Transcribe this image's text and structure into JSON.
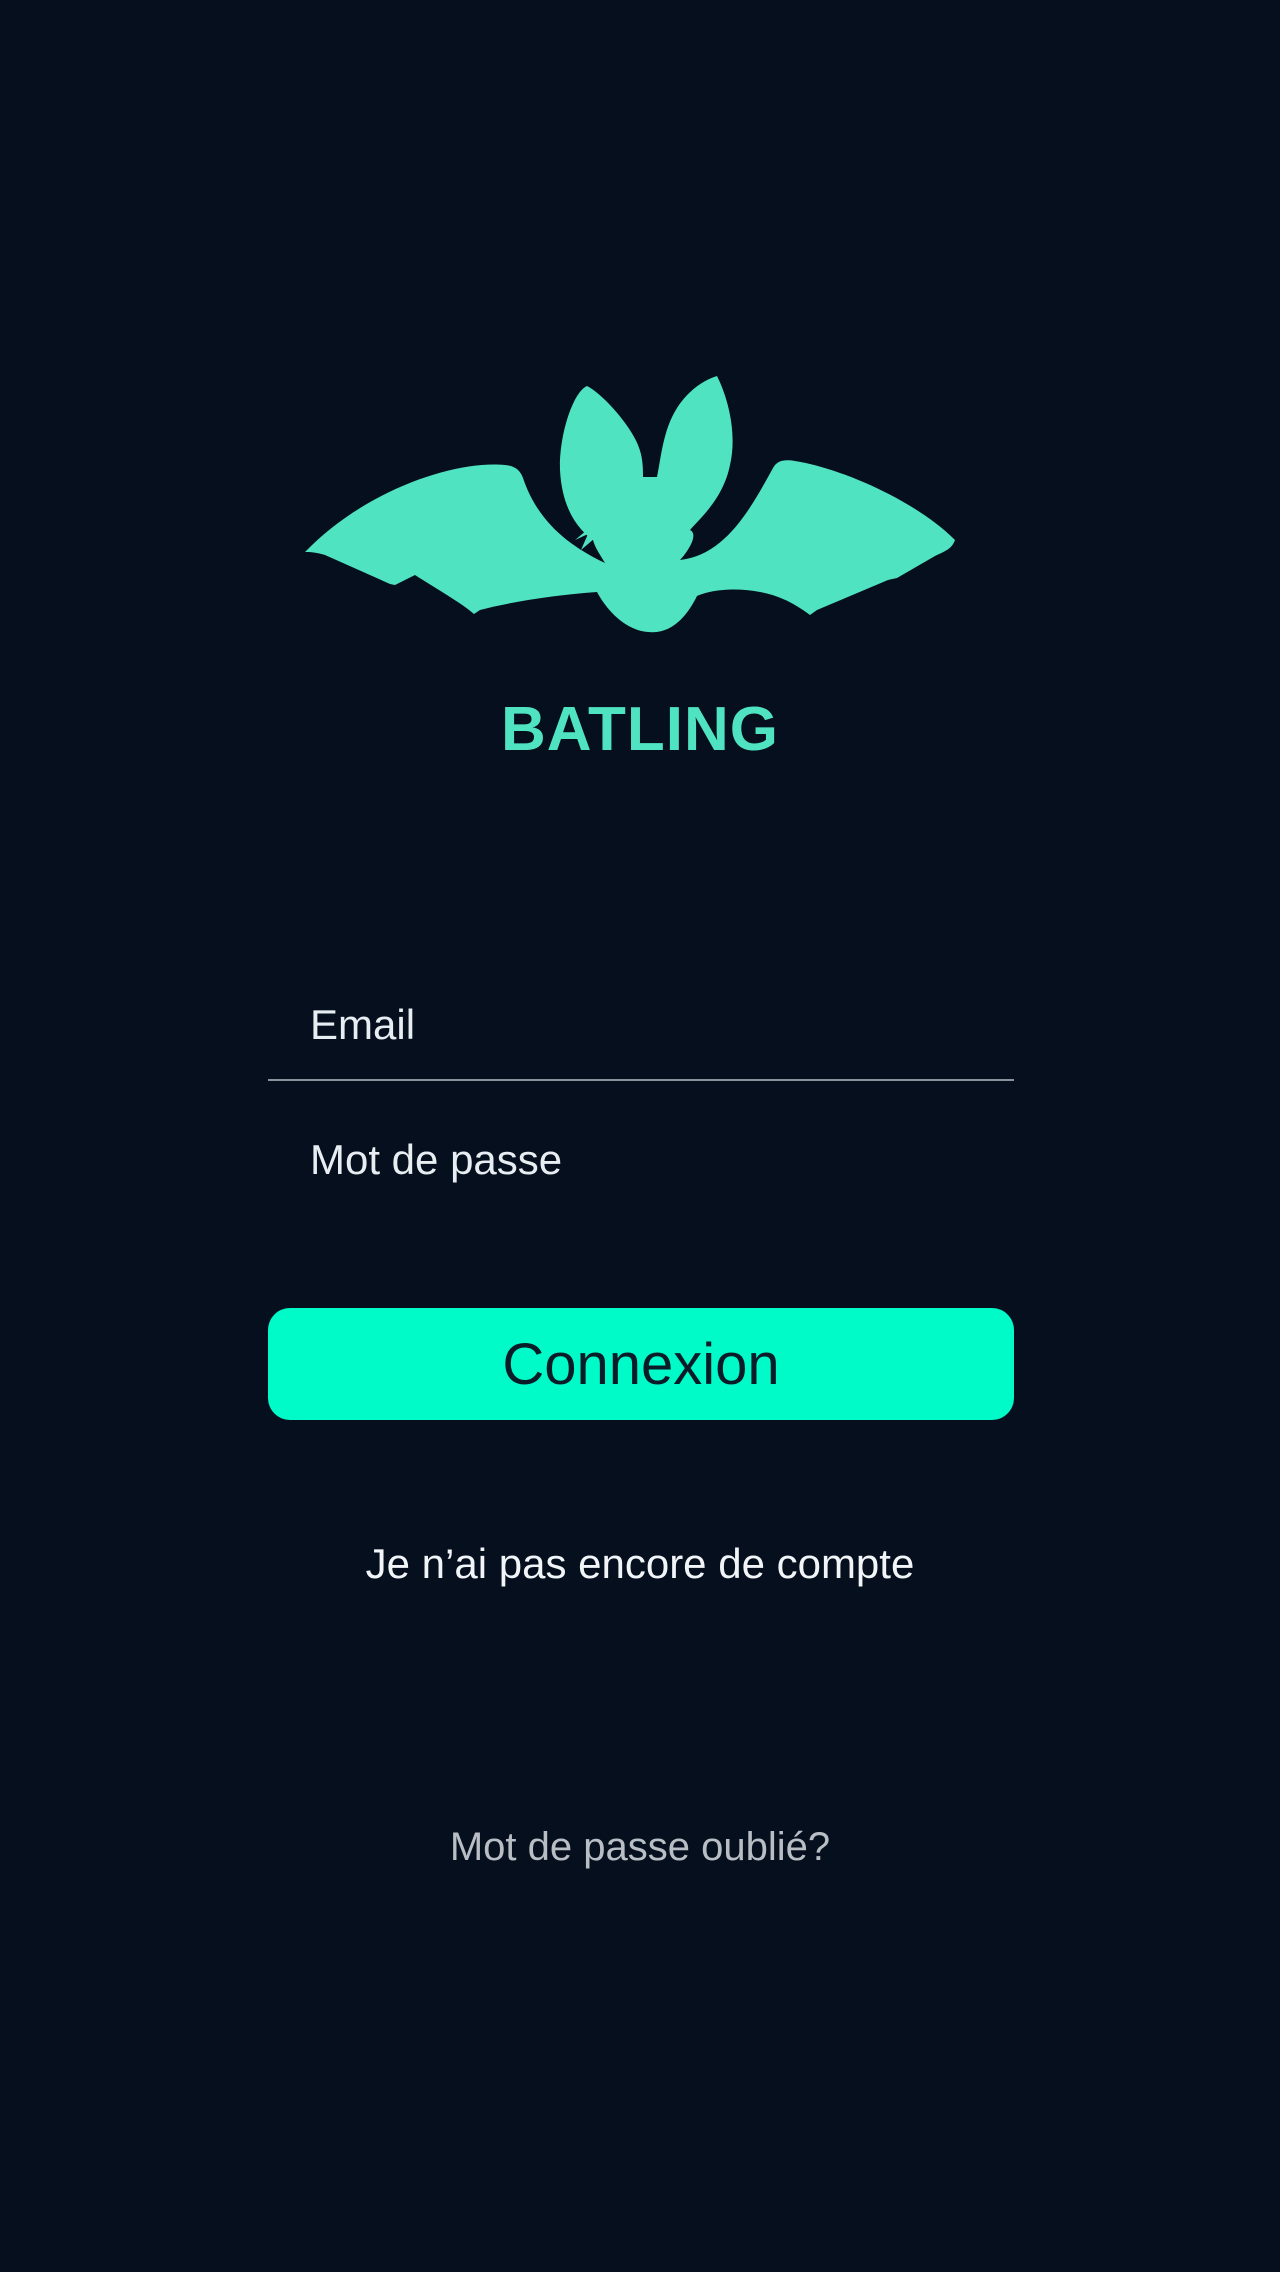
{
  "app": {
    "name": "BATLING",
    "logo_icon": "bat-icon"
  },
  "colors": {
    "background": "#050f1e",
    "brand": "#50e3c2",
    "accent": "#00fac8"
  },
  "form": {
    "email_placeholder": "Email",
    "email_value": "",
    "password_placeholder": "Mot de passe",
    "password_value": "",
    "submit_label": "Connexion"
  },
  "links": {
    "signup": "Je n’ai pas encore de compte",
    "forgot_password": "Mot de passe oublié?"
  }
}
